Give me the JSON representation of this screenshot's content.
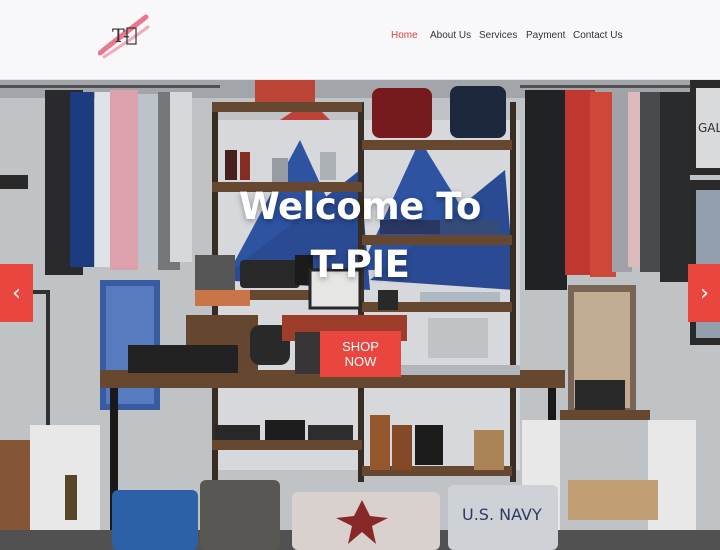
{
  "brand": {
    "logo_text": "T-"
  },
  "nav": {
    "items": [
      {
        "label": "Home",
        "active": true
      },
      {
        "label": "About Us",
        "active": false
      },
      {
        "label": "Services",
        "active": false
      },
      {
        "label": "Payment",
        "active": false
      },
      {
        "label": "Contact Us",
        "active": false
      }
    ]
  },
  "hero": {
    "title_line1": "Welcome To",
    "title_line2": "T-PIE",
    "cta_label": "SHOP NOW",
    "prev_icon": "‹",
    "next_icon": "›",
    "shirt_print": "U.S. NAVY",
    "sign_text": "GAL"
  },
  "colors": {
    "accent": "#e8463f",
    "nav_active": "#e0403a",
    "header_bg": "#f8f8fa"
  }
}
